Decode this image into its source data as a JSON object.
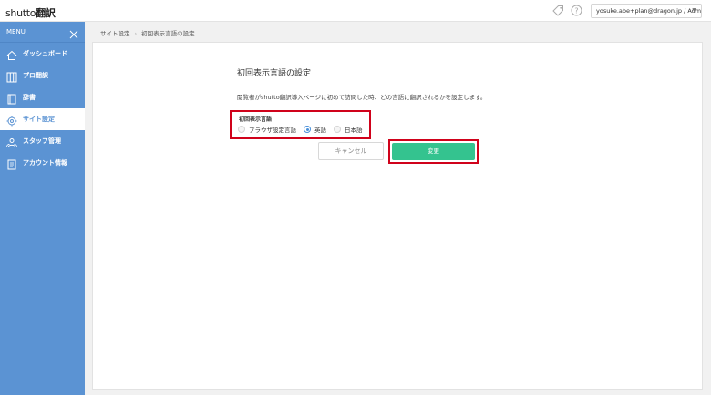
{
  "header": {
    "logo": "shutto",
    "logo_sub": "翻訳",
    "user_menu": "yosuke.abe+plan@dragon.jp / Admin",
    "icons": [
      "tag-icon",
      "help-icon"
    ]
  },
  "sidebar": {
    "menu_label": "MENU",
    "items": [
      {
        "label": "ダッシュボード",
        "icon": "home-icon"
      },
      {
        "label": "プロ翻訳",
        "icon": "grid-icon"
      },
      {
        "label": "辞書",
        "icon": "book-icon"
      },
      {
        "label": "サイト設定",
        "icon": "gear-icon",
        "active": true
      },
      {
        "label": "スタッフ管理",
        "icon": "users-icon"
      },
      {
        "label": "アカウント情報",
        "icon": "document-icon"
      }
    ]
  },
  "breadcrumb": {
    "parent": "サイト設定",
    "current": "初回表示言語の設定"
  },
  "main": {
    "title": "初回表示言語の設定",
    "description": "閲覧者がshutto翻訳導入ページに初めて訪問した時、どの言語に翻訳されるかを設定します。",
    "field_label": "初回表示言語",
    "options": [
      {
        "label": "ブラウザ設定言語",
        "selected": false
      },
      {
        "label": "英語",
        "selected": true
      },
      {
        "label": "日本語",
        "selected": false
      }
    ],
    "cancel_label": "キャンセル",
    "save_label": "変更"
  },
  "colors": {
    "sidebar": "#5b93d3",
    "primary_button": "#34c38f",
    "highlight": "#d0021b"
  }
}
